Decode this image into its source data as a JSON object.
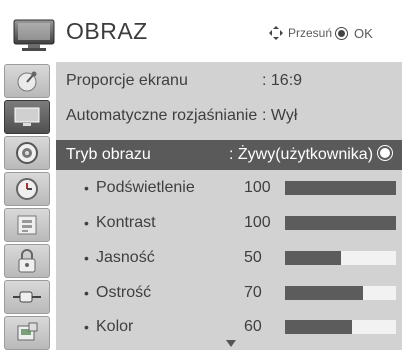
{
  "header": {
    "title": "OBRAZ",
    "move_hint": "Przesuń",
    "ok_hint": "OK"
  },
  "sidebar": {
    "items": [
      {
        "icon": "satellite-icon"
      },
      {
        "icon": "tv-picture-icon",
        "active": true
      },
      {
        "icon": "speaker-audio-icon"
      },
      {
        "icon": "clock-time-icon"
      },
      {
        "icon": "settings-box-icon"
      },
      {
        "icon": "lock-icon"
      },
      {
        "icon": "input-plug-icon"
      },
      {
        "icon": "usb-media-icon"
      }
    ]
  },
  "menu": {
    "items": [
      {
        "label": "Proporcje ekranu",
        "value": ": 16:9"
      },
      {
        "label": "Automatyczne rozjaśnianie",
        "value": ": Wył"
      },
      {
        "label": "Tryb obrazu",
        "value": ": Żywy(użytkownika)",
        "selected": true
      }
    ],
    "sub_items": [
      {
        "label": "Podświetlenie",
        "value": "100",
        "level": 1.0
      },
      {
        "label": "Kontrast",
        "value": "100",
        "level": 1.0
      },
      {
        "label": "Jasność",
        "value": "50",
        "level": 0.5
      },
      {
        "label": "Ostrość",
        "value": "70",
        "level": 0.7
      },
      {
        "label": "Kolor",
        "value": "60",
        "level": 0.6
      }
    ],
    "more_indicator": "arrow-down-icon"
  },
  "colors": {
    "panel_bg": "#d2d2d2",
    "selected_bg": "#5a5a5a",
    "bar_fill": "#5c5c5c",
    "bar_track": "#f2f2f2"
  }
}
